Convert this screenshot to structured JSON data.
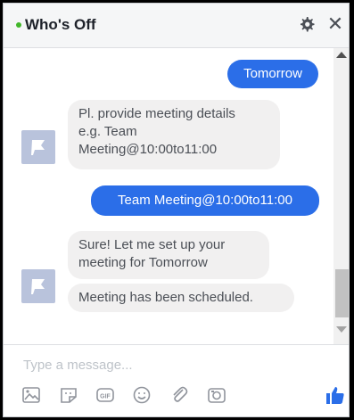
{
  "header": {
    "title": "Who's Off",
    "settings_icon": "gear-icon",
    "close_glyph": "✕",
    "status_color": "#42b72a"
  },
  "messages": [
    {
      "direction": "out",
      "text": "Tomorrow"
    },
    {
      "direction": "in",
      "lines": [
        "Pl. provide meeting details",
        "e.g. Team",
        "Meeting@10:00to11:00"
      ]
    },
    {
      "direction": "out",
      "text": "Team Meeting@10:00to11:00"
    },
    {
      "direction": "in",
      "lines": [
        "Sure! Let me set up your",
        "meeting for Tomorrow"
      ]
    },
    {
      "direction": "in",
      "text": "Meeting has been scheduled."
    }
  ],
  "composer": {
    "placeholder": "Type a message...",
    "tools": [
      "photo-icon",
      "sticker-icon",
      "gif-icon",
      "emoji-icon",
      "attachment-icon",
      "camera-icon"
    ],
    "send_icon": "thumbs-up-icon"
  },
  "colors": {
    "outgoing_bubble": "#2b6ee8",
    "incoming_bubble": "#f1f0f0",
    "accent": "#2b6ee8"
  }
}
